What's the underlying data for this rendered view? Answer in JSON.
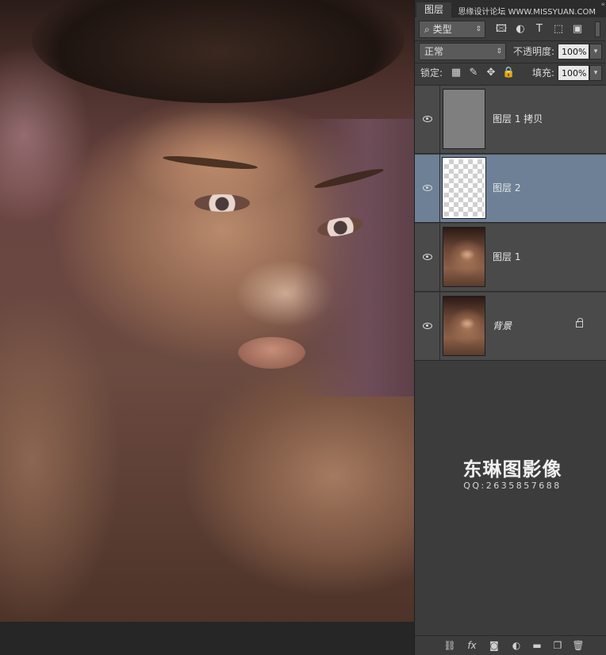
{
  "canvas": {
    "description_label": ""
  },
  "panel": {
    "tab_label": "图层",
    "top_watermark": "思缘设计论坛 WWW.MISSYUAN.COM",
    "collapse_glyph": "«",
    "filter": {
      "value": "类型",
      "search_glyph": "⌕",
      "arrow": "⇕"
    },
    "filter_icons": {
      "image": "🖾",
      "adjust": "◐",
      "type": "T",
      "shape": "⬚",
      "smart": "▣"
    },
    "blend": {
      "value": "正常",
      "arrow": "⇕"
    },
    "opacity": {
      "label": "不透明度:",
      "value": "100%",
      "arrow": "▾"
    },
    "lock": {
      "label": "锁定:"
    },
    "lock_icons": {
      "pixels": "▦",
      "paint": "✎",
      "move": "✥",
      "all": "🔒"
    },
    "fill": {
      "label": "填充:",
      "value": "100%",
      "arrow": "▾"
    },
    "layers": [
      {
        "name": "图层 1 拷贝",
        "thumb": "gray",
        "selected": false,
        "locked": false
      },
      {
        "name": "图层 2",
        "thumb": "transparent",
        "selected": true,
        "locked": false
      },
      {
        "name": "图层 1",
        "thumb": "photo",
        "selected": false,
        "locked": false
      },
      {
        "name": "背景",
        "thumb": "photo",
        "selected": false,
        "locked": true
      }
    ],
    "brand": {
      "name": "东琳图影像",
      "qq": "QQ:2635857688"
    },
    "bottom_icons": {
      "link": "⛓",
      "fx": "fx",
      "mask": "◙",
      "adjust": "◐",
      "group": "▬",
      "new": "❐",
      "trash": "🗑"
    }
  },
  "colors": {
    "panel_bg": "#3c3c3c",
    "selected_layer": "#6d8096",
    "tab_bg": "#2c2c2c"
  }
}
